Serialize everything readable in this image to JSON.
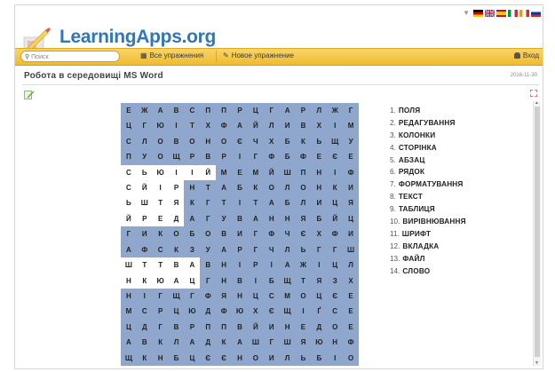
{
  "header": {
    "logo_text": "LearningApps.org",
    "flags": [
      "de",
      "gb",
      "es",
      "it",
      "fr",
      "ru"
    ]
  },
  "navbar": {
    "search_placeholder": "Поиск",
    "all_exercises": "Все упражнения",
    "new_exercise": "Новое упражнение",
    "login": "Вход"
  },
  "page": {
    "title": "Робота в середовищі MS Word",
    "date": "2016-11-30"
  },
  "puzzle": {
    "rows": [
      "ЕЖАВСППРЦГАРЛЖГ",
      "ЦГЮІТХФАЙЛИВХІМ",
      "СЛОВОНОЄЧХБКЬЩУ",
      "ПУОЩРВРІГФБФЕЄЕ",
      "СЬЮІІЙМЕМЙШПНІФ",
      "СЙІРНТАБКОЛОНКИ",
      "ЬШТЯКГТІТАБЛИЦЯ",
      "ЙРЕДАГУВАННЯБЙЦ",
      "ГИКОБОВИГФЧЄХФИ",
      "АФСКЗУАРГЧЛЬГГШ",
      "ШТТВАВНІРІАЖІЦЛ",
      "НКЮАЦГНВІБЩТЯЗХ",
      "НІГЩГФЯНЦСМОЦЄЕ",
      "МСРЦЮДФЮХЄЩІҐСЕ",
      "ЦДГВРППВЙИНЕДОЕ",
      "АВКЛАДКАШГШЯЮНФ",
      "ЩКНБЦЄЄНОИЛЬБІО"
    ],
    "words": [
      "ПОЛЯ",
      "РЕДАГУВАННЯ",
      "КОЛОНКИ",
      "СТОРІНКА",
      "АБЗАЦ",
      "РЯДОК",
      "ФОРМАТУВАННЯ",
      "ТЕКСТ",
      "ТАБЛИЦЯ",
      "ВИРІВНЮВАННЯ",
      "ШРИФТ",
      "ВКЛАДКА",
      "ФАЙЛ",
      "СЛОВО"
    ]
  }
}
